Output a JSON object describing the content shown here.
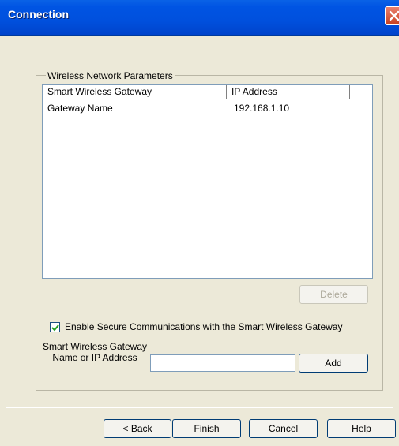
{
  "window": {
    "title": "Connection",
    "close_icon": "close-icon"
  },
  "group": {
    "legend": "Wireless Network Parameters"
  },
  "list": {
    "columns": [
      "Smart Wireless Gateway",
      "IP Address"
    ],
    "rows": [
      {
        "name": "Gateway Name",
        "ip": "192.168.1.10"
      }
    ]
  },
  "buttons": {
    "delete": "Delete",
    "add": "Add",
    "back": "< Back",
    "finish": "Finish",
    "cancel": "Cancel",
    "help": "Help"
  },
  "secure": {
    "label": "Enable Secure Communications with the Smart Wireless Gateway",
    "checked": true
  },
  "gateway_field": {
    "label": "Smart Wireless Gateway Name or IP Address",
    "value": ""
  },
  "colors": {
    "title_bar": "#0054e3",
    "dialog_bg": "#ece9d8",
    "checkmark": "#21a121"
  }
}
